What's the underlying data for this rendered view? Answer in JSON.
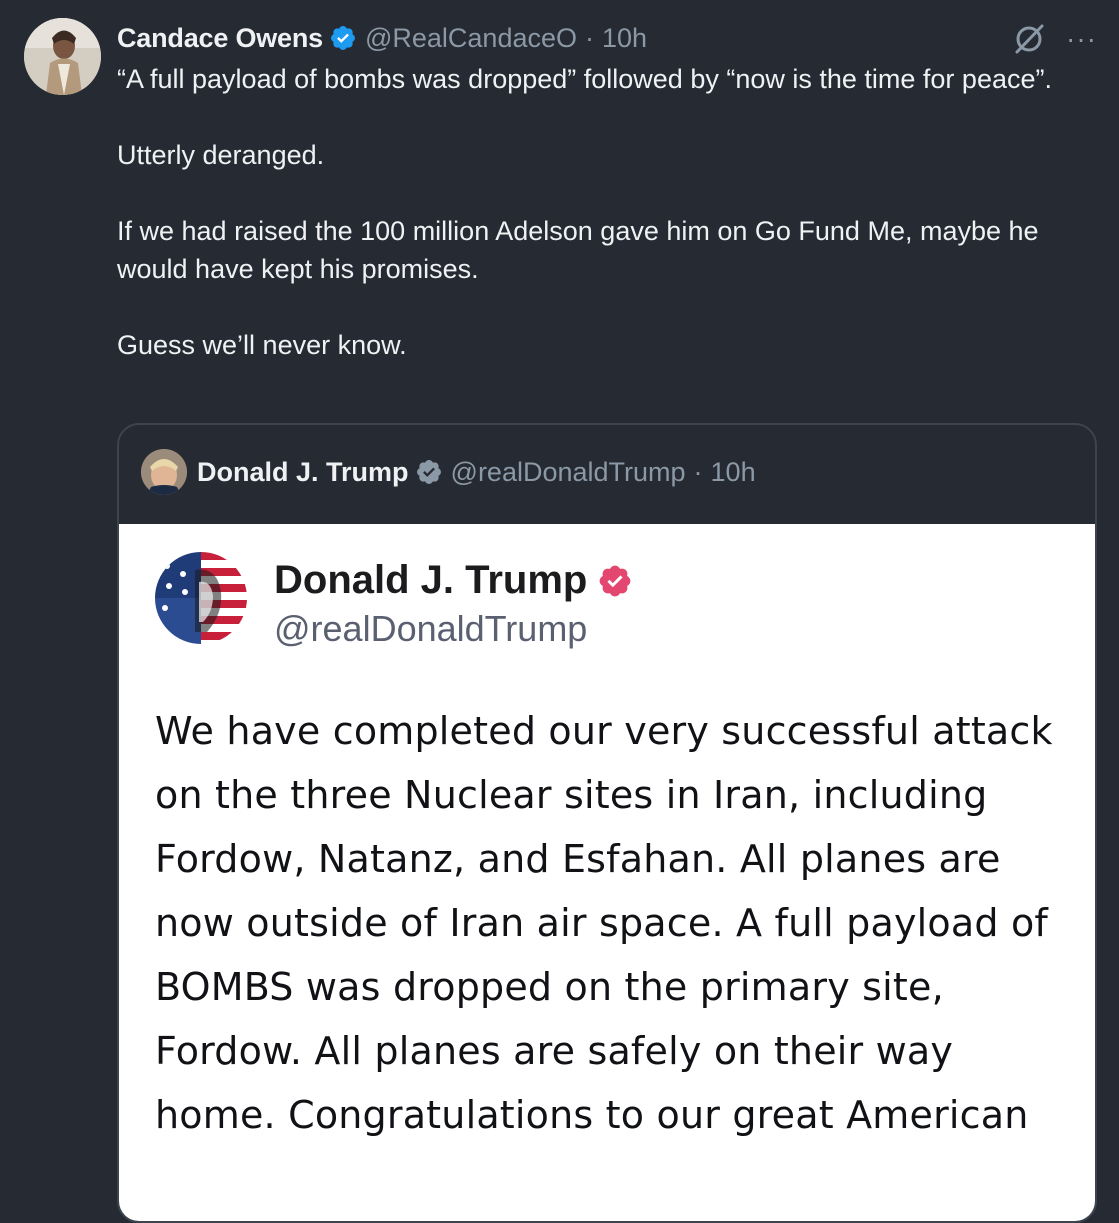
{
  "tweet": {
    "author_name": "Candace Owens",
    "handle": "@RealCandaceO",
    "separator": "·",
    "time": "10h",
    "more_label": "···",
    "paragraphs": [
      "“A full payload of bombs was dropped” followed by “now is the time for peace”.",
      "Utterly deranged.",
      "If we had raised the 100 million Adelson gave him on Go Fund Me, maybe he would have kept his promises.",
      "Guess we’ll never know."
    ]
  },
  "quote": {
    "author_name": "Donald J. Trump",
    "handle": "@realDonaldTrump",
    "separator": "·",
    "time": "10h",
    "embed": {
      "author_name": "Donald J. Trump",
      "handle": "@realDonaldTrump",
      "text": "We have completed our very successful attack on the three Nuclear sites in Iran, including Fordow, Natanz, and Esfahan. All planes are now outside of Iran air space. A full payload of BOMBS was dropped on the primary site, Fordow. All planes are safely on their way home. Congratulations to our great American"
    }
  },
  "colors": {
    "background": "#252a33",
    "verified_blue": "#1d9bf0",
    "truth_verified": "#e3466f",
    "secondary_text": "#8b98a5"
  }
}
